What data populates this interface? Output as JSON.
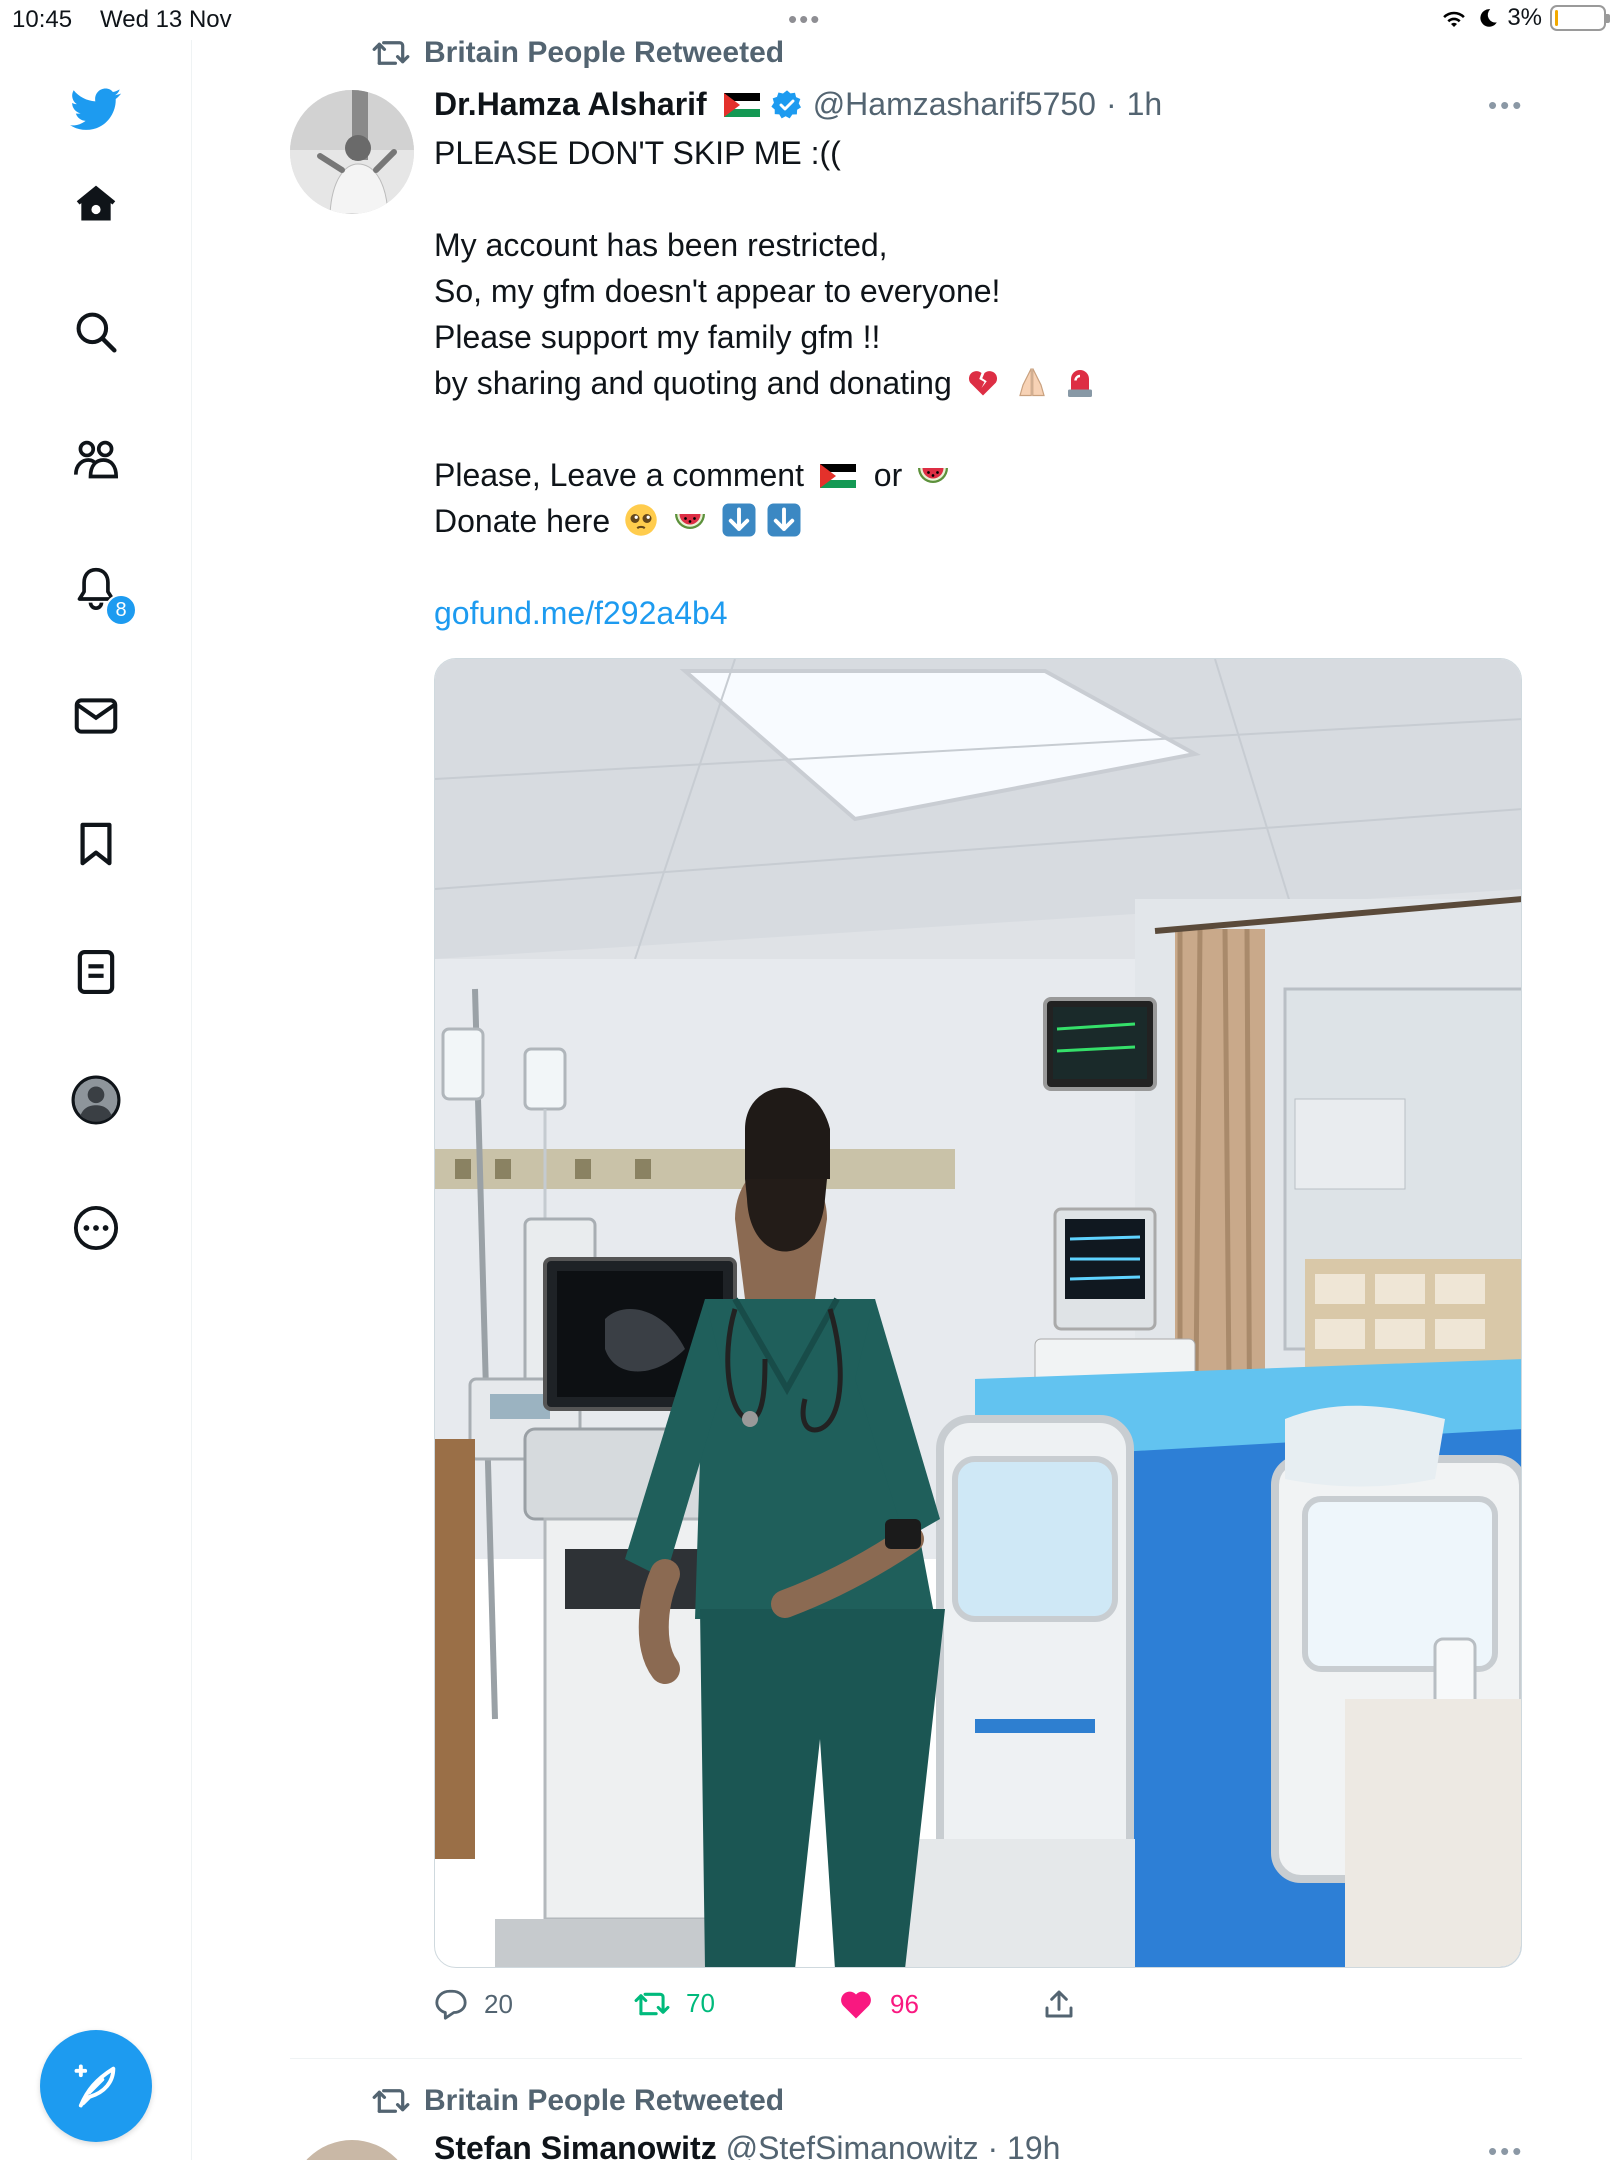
{
  "status_bar": {
    "time": "10:45",
    "date": "Wed 13 Nov",
    "battery": "3%",
    "battery_level": 0.03
  },
  "sidebar": {
    "notifications_badge": "8",
    "items": [
      {
        "icon": "twitter-logo-icon"
      },
      {
        "icon": "home-icon"
      },
      {
        "icon": "search-icon"
      },
      {
        "icon": "communities-icon"
      },
      {
        "icon": "notifications-bell-icon"
      },
      {
        "icon": "messages-icon"
      },
      {
        "icon": "bookmarks-icon"
      },
      {
        "icon": "lists-icon"
      },
      {
        "icon": "profile-icon"
      },
      {
        "icon": "more-circle-icon"
      }
    ],
    "compose_icon": "compose-feather-icon"
  },
  "tweet": {
    "retweeted_by": "Britain People Retweeted",
    "author_name": "Dr.Hamza Alsharif",
    "author_handle": "@Hamzasharif5750",
    "separator": "·",
    "time": "1h",
    "lines": [
      "PLEASE DON'T SKIP ME :((",
      "",
      "My account has been restricted,",
      "So, my gfm doesn't appear to everyone!",
      "Please support my family gfm !!",
      "by sharing and quoting and donating",
      "",
      "Please, Leave a comment",
      "Donate here"
    ],
    "or_word": "or",
    "link": "gofund.me/f292a4b4",
    "stats": {
      "replies": "20",
      "retweets": "70",
      "likes": "96"
    }
  },
  "next_tweet": {
    "retweeted_by": "Britain People Retweeted",
    "author_name": "Stefan Simanowitz",
    "author_handle": "@StefSimanowitz",
    "separator": "·",
    "time": "19h"
  },
  "colors": {
    "accent": "#1d9bf0",
    "retweet_green": "#00ba7c",
    "like_pink": "#f91880",
    "muted": "#536471",
    "scrub_teal": "#1f5f5b"
  }
}
